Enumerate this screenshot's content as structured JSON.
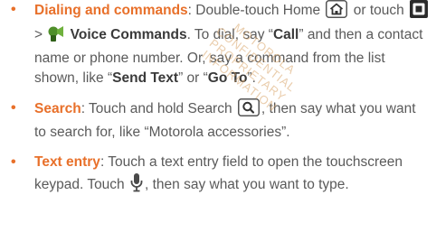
{
  "colors": {
    "accent": "#e8702a",
    "text": "#5a5a5a",
    "watermark": "#d9a56a"
  },
  "icons": {
    "home": "home-icon",
    "apps": "apps-icon",
    "voice": "voice-commands-icon",
    "search": "search-icon",
    "mic": "microphone-icon"
  },
  "items": [
    {
      "bullet": "•",
      "term": "Dialing and commands",
      "t1": ": Double-touch Home ",
      "t2": " or touch ",
      "t3": " > ",
      "b1": "Voice Commands",
      "t4": ". To dial, say “",
      "b2": "Call",
      "t5": "” and then a contact name or phone number. Or, say a command from the list shown, like “",
      "b3": "Send Text",
      "t6": "” or “",
      "b4": "Go To",
      "t7": "”."
    },
    {
      "bullet": "•",
      "term": "Search",
      "t1": ": Touch and hold Search ",
      "t2": ", then say what you want to search for, like “Motorola accessories”."
    },
    {
      "bullet": "•",
      "term": "Text entry",
      "t1": ": Touch a text entry field to open the touchscreen keypad. Touch ",
      "t2": ", then say what you want to type."
    }
  ],
  "watermark": {
    "line1": "MOTOROLA CONFIDENTIAL",
    "line2": "PROPRIETARY INFORMATION"
  }
}
